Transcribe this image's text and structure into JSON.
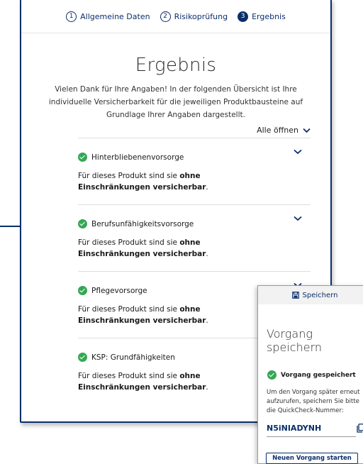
{
  "steps": [
    {
      "number": "1",
      "label": "Allgemeine Daten"
    },
    {
      "number": "2",
      "label": "Risikoprüfung"
    },
    {
      "number": "3",
      "label": "Ergebnis"
    }
  ],
  "title": "Ergebnis",
  "intro": "Vielen Dank für Ihre Angaben! In der folgenden Übersicht ist Ihre individuelle Versicherbarkeit für die jeweiligen Produktbausteine auf Grundlage Ihrer Angaben dargestellt.",
  "open_all_label": "Alle öffnen",
  "items": [
    {
      "name": "Hinterbliebenenvorsorge",
      "text_prefix": "Für dieses Produkt sind sie ",
      "text_bold": "ohne Einschränkungen versicherbar",
      "text_suffix": "."
    },
    {
      "name": "Berufsunfähigkeitsvorsorge",
      "text_prefix": "Für dieses Produkt sind sie ",
      "text_bold": "ohne Einschränkungen versicherbar",
      "text_suffix": "."
    },
    {
      "name": "Pflegevorsorge",
      "text_prefix": "Für dieses Produkt sind sie ",
      "text_bold": "ohne Einschränkungen versicherbar",
      "text_suffix": "."
    },
    {
      "name": "KSP: Grundfähigkeiten",
      "text_prefix": "Für dieses Produkt sind sie ",
      "text_bold": "ohne Einschränkungen versicherbar",
      "text_suffix": "."
    }
  ],
  "popup": {
    "save_tab_label": "Speichern",
    "title": "Vorgang speichern",
    "saved_label": "Vorgang gespeichert",
    "text": "Um den Vorgang später erneut aufzurufen, speichern Sie bitte die QuickCheck-Nummer:",
    "code": "N5iNIADYNH",
    "new_button_label": "Neuen Vorgang starten"
  },
  "colors": {
    "accent": "#0b2e6b",
    "success": "#34a853"
  }
}
